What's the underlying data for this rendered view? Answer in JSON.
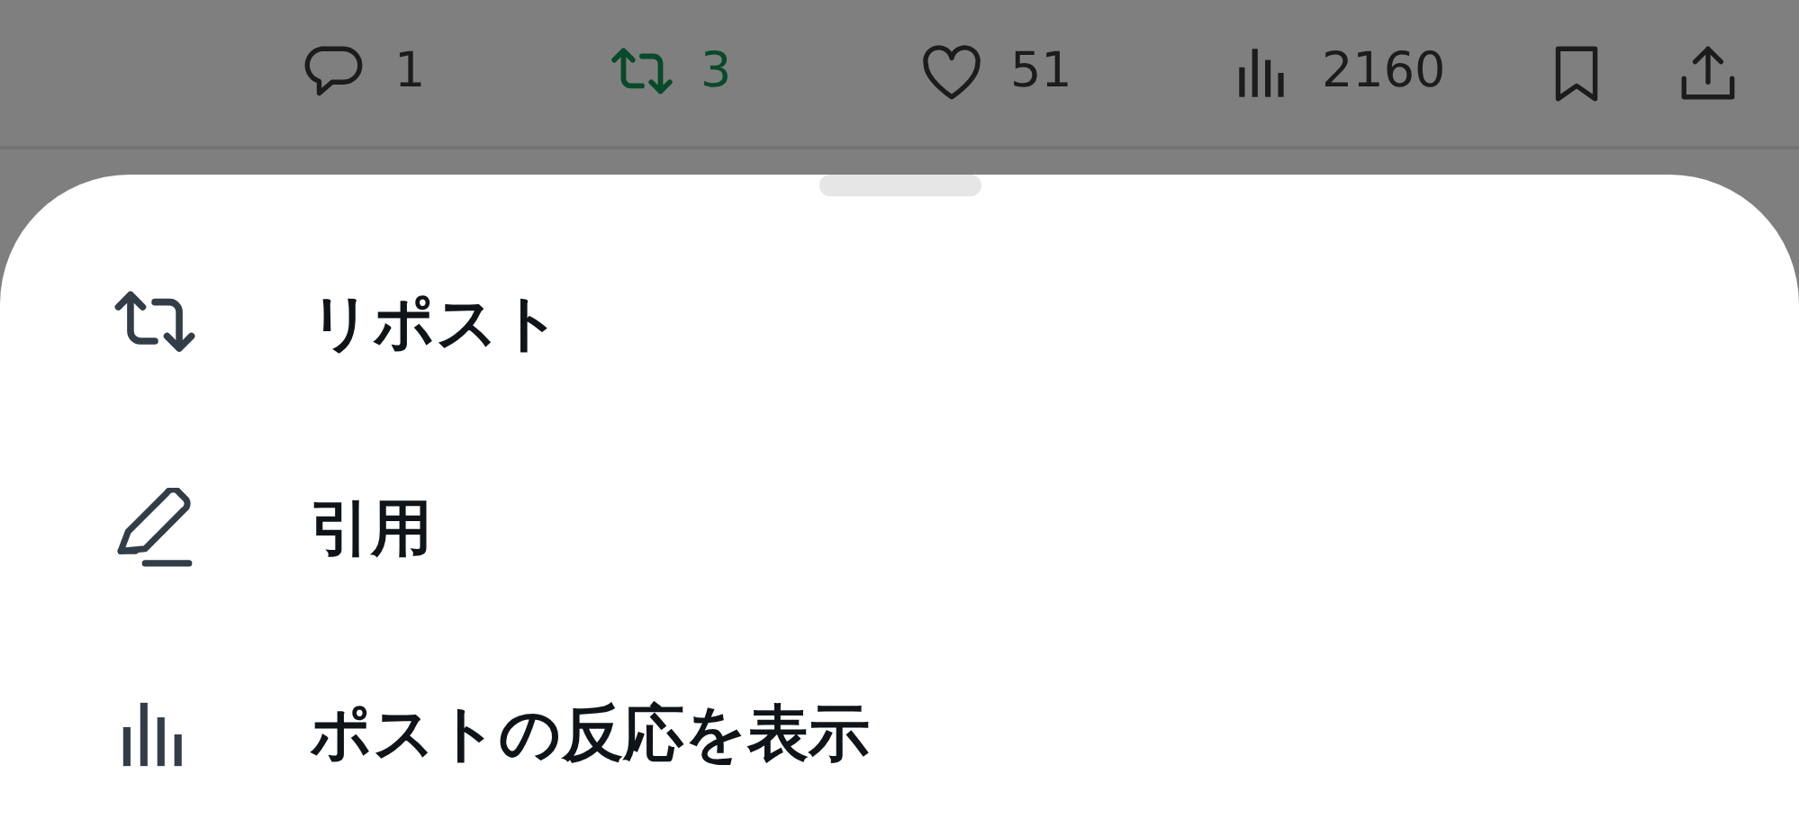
{
  "action_bar": {
    "actions": [
      {
        "kind": "reply",
        "count": "1",
        "active": false
      },
      {
        "kind": "repost",
        "count": "3",
        "active": true
      },
      {
        "kind": "like",
        "count": "51",
        "active": false
      },
      {
        "kind": "views",
        "count": "2160"
      },
      {
        "kind": "bookmark",
        "active": false
      },
      {
        "kind": "share"
      }
    ]
  },
  "sheet": {
    "items": [
      {
        "kind": "repost",
        "label": "リポスト"
      },
      {
        "kind": "quote",
        "label": "引用"
      },
      {
        "kind": "stats",
        "label": "ポストの反応を表示"
      }
    ]
  }
}
